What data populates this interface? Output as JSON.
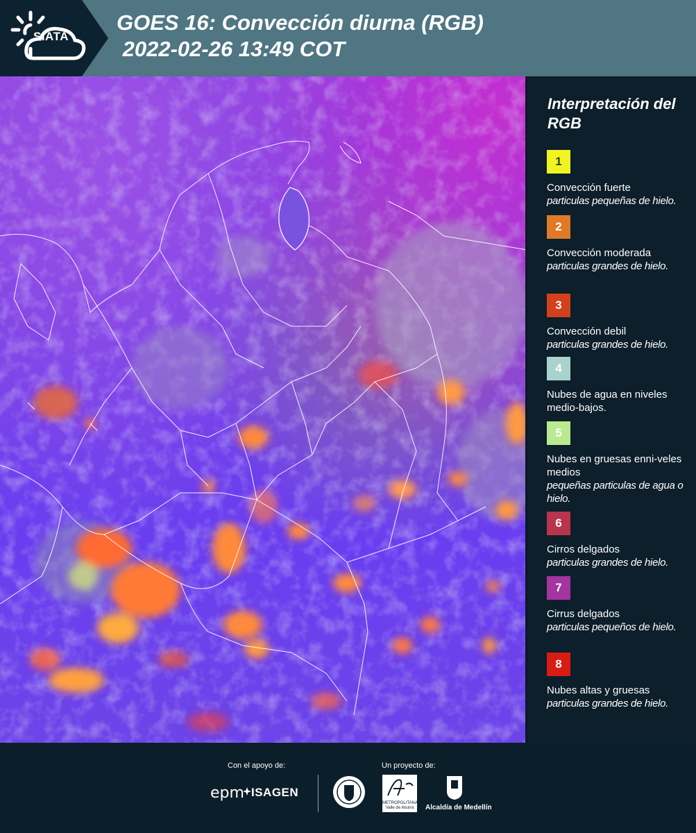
{
  "header": {
    "logo_text": "SIATA",
    "title": "GOES 16: Convección diurna (RGB)\n 2022-02-26 13:49 COT"
  },
  "legend": {
    "title": "Interpretación del RGB",
    "items": [
      {
        "number": "1",
        "color": "#f0f522",
        "text_color": "#3a3a10",
        "main": "Convección fuerte",
        "sub": "particulas pequeñas de hielo."
      },
      {
        "number": "2",
        "color": "#e07a28",
        "text_color": "#ffffff",
        "main": "Convección moderada",
        "sub": "particulas grandes de hielo."
      },
      {
        "number": "3",
        "color": "#d3401c",
        "text_color": "#ffffff",
        "main": "Convección debil",
        "sub": "particulas grandes de hielo."
      },
      {
        "number": "4",
        "color": "#a9d2cc",
        "text_color": "#ffffff",
        "main": "Nubes de agua en niveles medio-bajos.",
        "sub": ""
      },
      {
        "number": "5",
        "color": "#b8eb8f",
        "text_color": "#ffffff",
        "main": "Nubes en gruesas enni-veles medios",
        "sub": "pequeñas particulas de agua o hielo."
      },
      {
        "number": "6",
        "color": "#b8334e",
        "text_color": "#ffffff",
        "main": "Cirros delgados",
        "sub": "particulas grandes de hielo."
      },
      {
        "number": "7",
        "color": "#a533a0",
        "text_color": "#ffffff",
        "main": "Cirrus delgados",
        "sub": "particulas pequeños de hielo."
      },
      {
        "number": "8",
        "color": "#d81c14",
        "text_color": "#ffffff",
        "main": "Nubes altas y gruesas",
        "sub": "particulas grandes de hielo."
      }
    ]
  },
  "footer": {
    "support_label": "Con el apoyo de:",
    "project_label": "Un proyecto de:",
    "epm": "epm",
    "isagen": "ISAGEN",
    "amva_text": "METROPOLITANA Valle de Aburrá",
    "alcaldia": "Alcaldía de Medellín"
  }
}
